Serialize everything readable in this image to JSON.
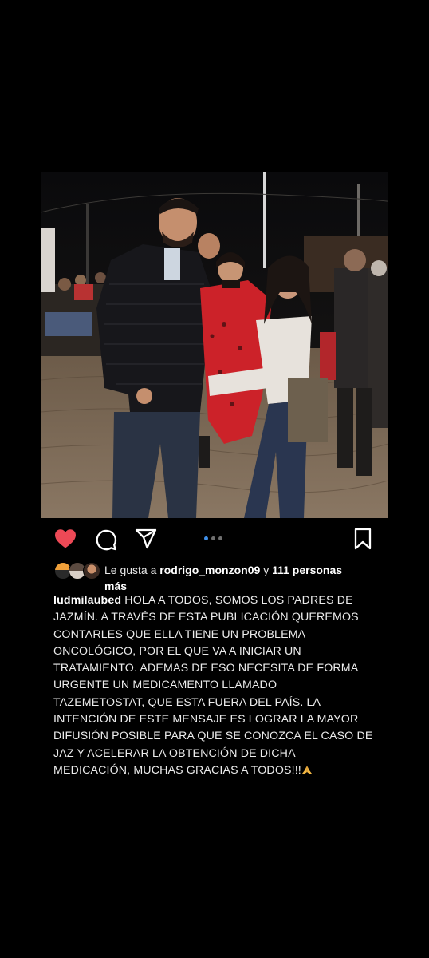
{
  "post": {
    "likes": {
      "prefix": "Le gusta a",
      "user": "rodrigo_monzon09",
      "joiner": "y",
      "count_text": "111 personas",
      "suffix": "más"
    },
    "caption": {
      "username": "ludmilaubed",
      "lines": [
        "HOLA A TODOS, SOMOS LOS PADRES DE",
        "JAZMÍN. A TRAVÉS DE ESTA PUBLICACIÓN QUEREMOS",
        "CONTARLES QUE ELLA TIENE UN PROBLEMA",
        "ONCOLÓGICO, POR EL QUE VA A INICIAR UN",
        "TRATAMIENTO. ADEMAS DE ESO NECESITA DE FORMA",
        "URGENTE UN MEDICAMENTO LLAMADO",
        "TAZEMETOSTAT, QUE ESTA FUERA DEL PAÍS. LA",
        "INTENCIÓN DE ESTE MENSAJE ES LOGRAR LA MAYOR",
        "DIFUSIÓN POSIBLE PARA QUE SE CONOZCA EL CASO DE",
        "JAZ Y ACELERAR LA OBTENCIÓN DE DICHA",
        "MEDICACIÓN, MUCHAS GRACIAS A TODOS!!!"
      ],
      "trailing_emoji": "folded-hands-emoji"
    },
    "carousel": {
      "total": 3,
      "active_index": 0
    },
    "colors": {
      "like": "#ed4956",
      "dot_active": "#3f8fe8",
      "background": "#000000"
    },
    "icons": [
      "heart-icon",
      "comment-icon",
      "share-icon",
      "bookmark-icon"
    ]
  }
}
